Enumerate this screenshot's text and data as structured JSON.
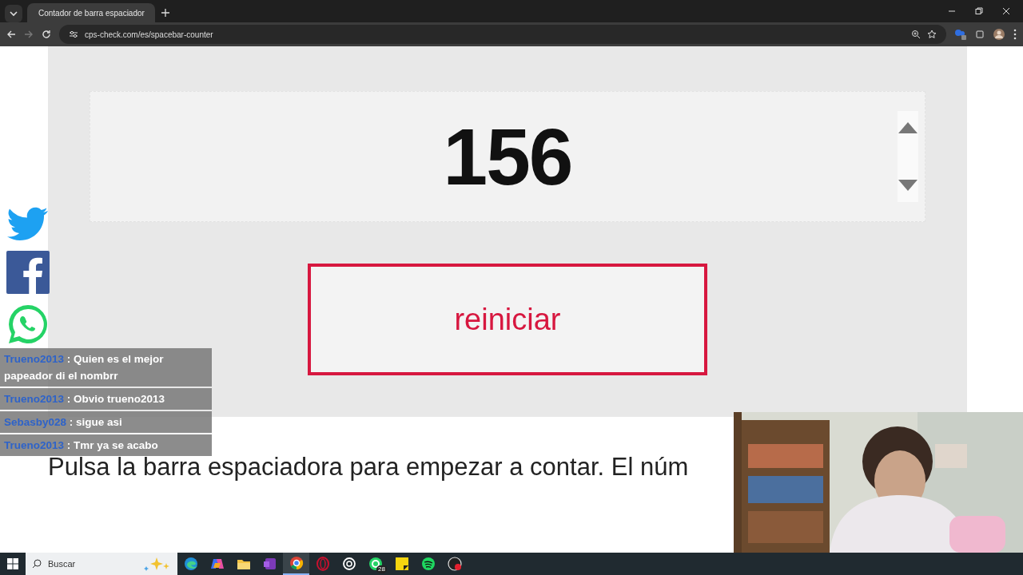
{
  "browser": {
    "tabs": [
      {
        "title": "Contador de barra espaciador",
        "selected": true
      }
    ],
    "url": "cps-check.com/es/spacebar-counter"
  },
  "counter": {
    "value": "156"
  },
  "reset_button": {
    "label": "reiniciar"
  },
  "instructions": "Pulsa la barra espaciadora para empezar a contar. El núm",
  "chat": [
    {
      "user": "Trueno2013",
      "message": ": Quien es el mejor papeador di el nombrr"
    },
    {
      "user": "Trueno2013",
      "message": ": Obvio trueno2013"
    },
    {
      "user": "Sebasby028",
      "message": ": sigue asi"
    },
    {
      "user": "Trueno2013",
      "message": ": Tmr ya se acabo"
    }
  ],
  "taskbar": {
    "search_placeholder": "Buscar",
    "apps": [
      {
        "kind": "edge",
        "active": false
      },
      {
        "kind": "copilot",
        "active": false
      },
      {
        "kind": "folder",
        "active": false
      },
      {
        "kind": "onenote",
        "active": false
      },
      {
        "kind": "chrome",
        "active": true
      },
      {
        "kind": "opera",
        "active": false
      },
      {
        "kind": "chatgpt",
        "active": false
      },
      {
        "kind": "whatsapp",
        "active": false,
        "badge": "28"
      },
      {
        "kind": "notes",
        "active": false
      },
      {
        "kind": "spotify",
        "active": false
      },
      {
        "kind": "obs",
        "active": false
      }
    ]
  }
}
